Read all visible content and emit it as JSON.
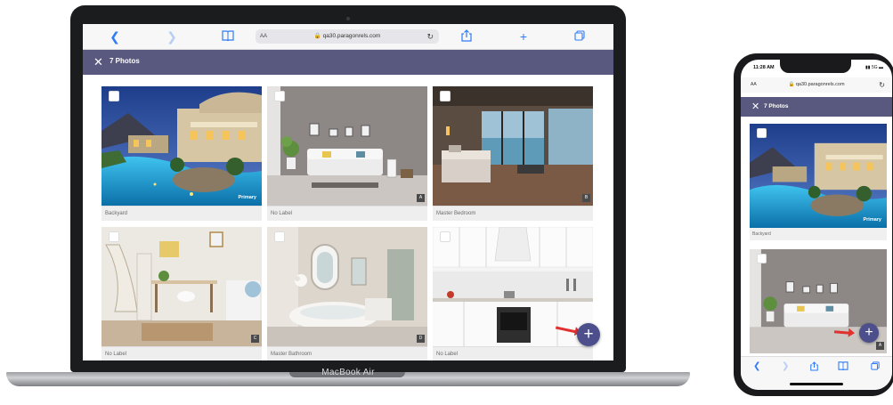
{
  "laptop": {
    "brand": "MacBook Air",
    "browser": {
      "url": "qa30.paragonrels.com",
      "text_size": "AA"
    },
    "app": {
      "title": "7 Photos",
      "photos": [
        {
          "label": "Backyard",
          "badge": "Primary",
          "tag": ""
        },
        {
          "label": "No Label",
          "badge": "",
          "tag": "A"
        },
        {
          "label": "Master Bedroom",
          "badge": "",
          "tag": "B"
        },
        {
          "label": "No Label",
          "badge": "",
          "tag": "C"
        },
        {
          "label": "Master Bathroom",
          "badge": "",
          "tag": "D"
        },
        {
          "label": "No Label",
          "badge": "",
          "tag": ""
        }
      ],
      "add_button": "+"
    }
  },
  "phone": {
    "time": "11:28 AM",
    "status": "5G",
    "browser": {
      "url": "qa30.paragonrels.com",
      "text_size": "AA"
    },
    "app": {
      "title": "7 Photos",
      "photos": [
        {
          "label": "Backyard",
          "badge": "Primary",
          "tag": ""
        },
        {
          "label": "",
          "badge": "",
          "tag": "A"
        }
      ],
      "add_button": "+"
    }
  },
  "icons": {
    "back": "chevron-left-icon",
    "forward": "chevron-right-icon",
    "bookmarks": "book-icon",
    "lock": "lock-icon",
    "reload": "reload-icon",
    "share": "share-icon",
    "new_tab": "plus-icon",
    "tabs": "tabs-icon",
    "close": "close-icon",
    "checkbox": "checkbox-icon",
    "add": "add-icon",
    "arrow": "red-arrow-icon"
  },
  "colors": {
    "header": "#59597f",
    "fab": "#4d4f8c",
    "safari_blue": "#2f7cf6",
    "arrow": "#e2302e"
  }
}
